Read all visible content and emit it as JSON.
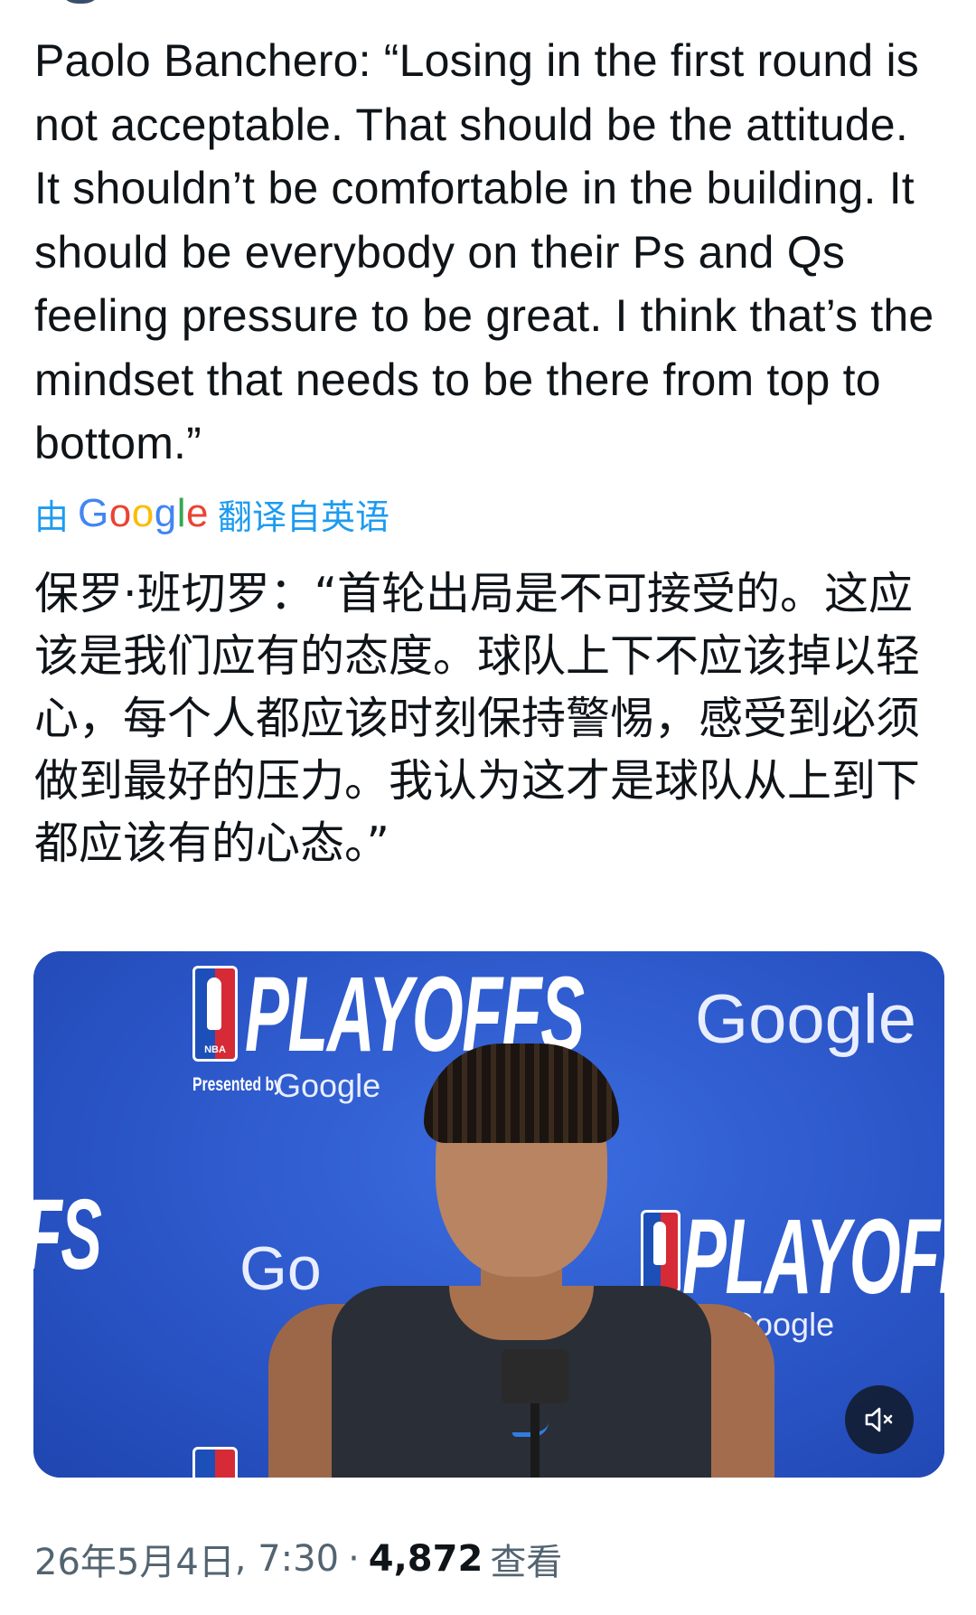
{
  "tweet": {
    "text": "Paolo Banchero: “Losing in the first round is not acceptable. That should be the attitude. It shouldn’t be comfortable in the building. It should be everybody on their Ps and Qs feeling pressure to be great. I think that’s the mindset that needs to be there from top to bottom.”",
    "translate": {
      "prefix": "由",
      "brand": "Google",
      "suffix": "翻译自英语"
    },
    "translated_text": "保罗·班切罗：“首轮出局是不可接受的。这应该是我们应有的态度。球队上下不应该掉以轻心，每个人都应该时刻保持警惕，感受到必须做到最好的压力。我认为这才是球队从上到下都应该有的心态。”"
  },
  "media": {
    "backdrop": {
      "playoffs_top": "PLAYOFFS",
      "presented_by": "Presented by",
      "google_small": "Google",
      "google_big": "Google",
      "playoffs_right": "PLAYOFF",
      "google_right": "Google",
      "google_mid": "Go",
      "fs_left": "FS",
      "nba": "NBA"
    },
    "mute_icon": "speaker-muted-icon"
  },
  "meta": {
    "date": "26年5月4日",
    "time": "7:30",
    "separator": "·",
    "views_count": "4,872",
    "views_label": "查看"
  },
  "colors": {
    "text": "#0f1419",
    "link": "#1d9bf0",
    "muted": "#536471",
    "backdrop": "#2f5fd3"
  }
}
